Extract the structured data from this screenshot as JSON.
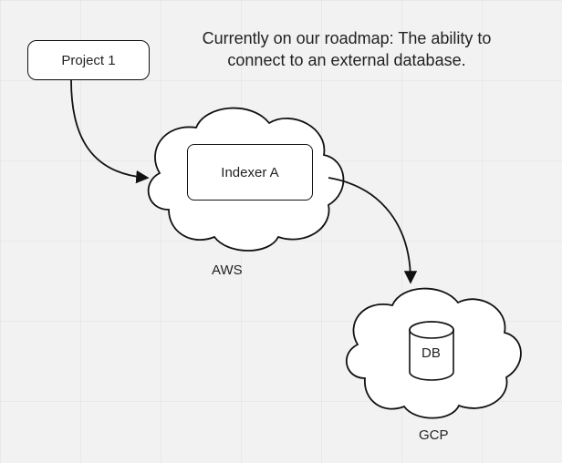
{
  "caption": "Currently on our roadmap: The ability to connect to an external database.",
  "nodes": {
    "project": {
      "label": "Project 1"
    },
    "indexer": {
      "label": "Indexer A"
    },
    "db": {
      "label": "DB"
    }
  },
  "clouds": {
    "aws": {
      "label": "AWS"
    },
    "gcp": {
      "label": "GCP"
    }
  }
}
